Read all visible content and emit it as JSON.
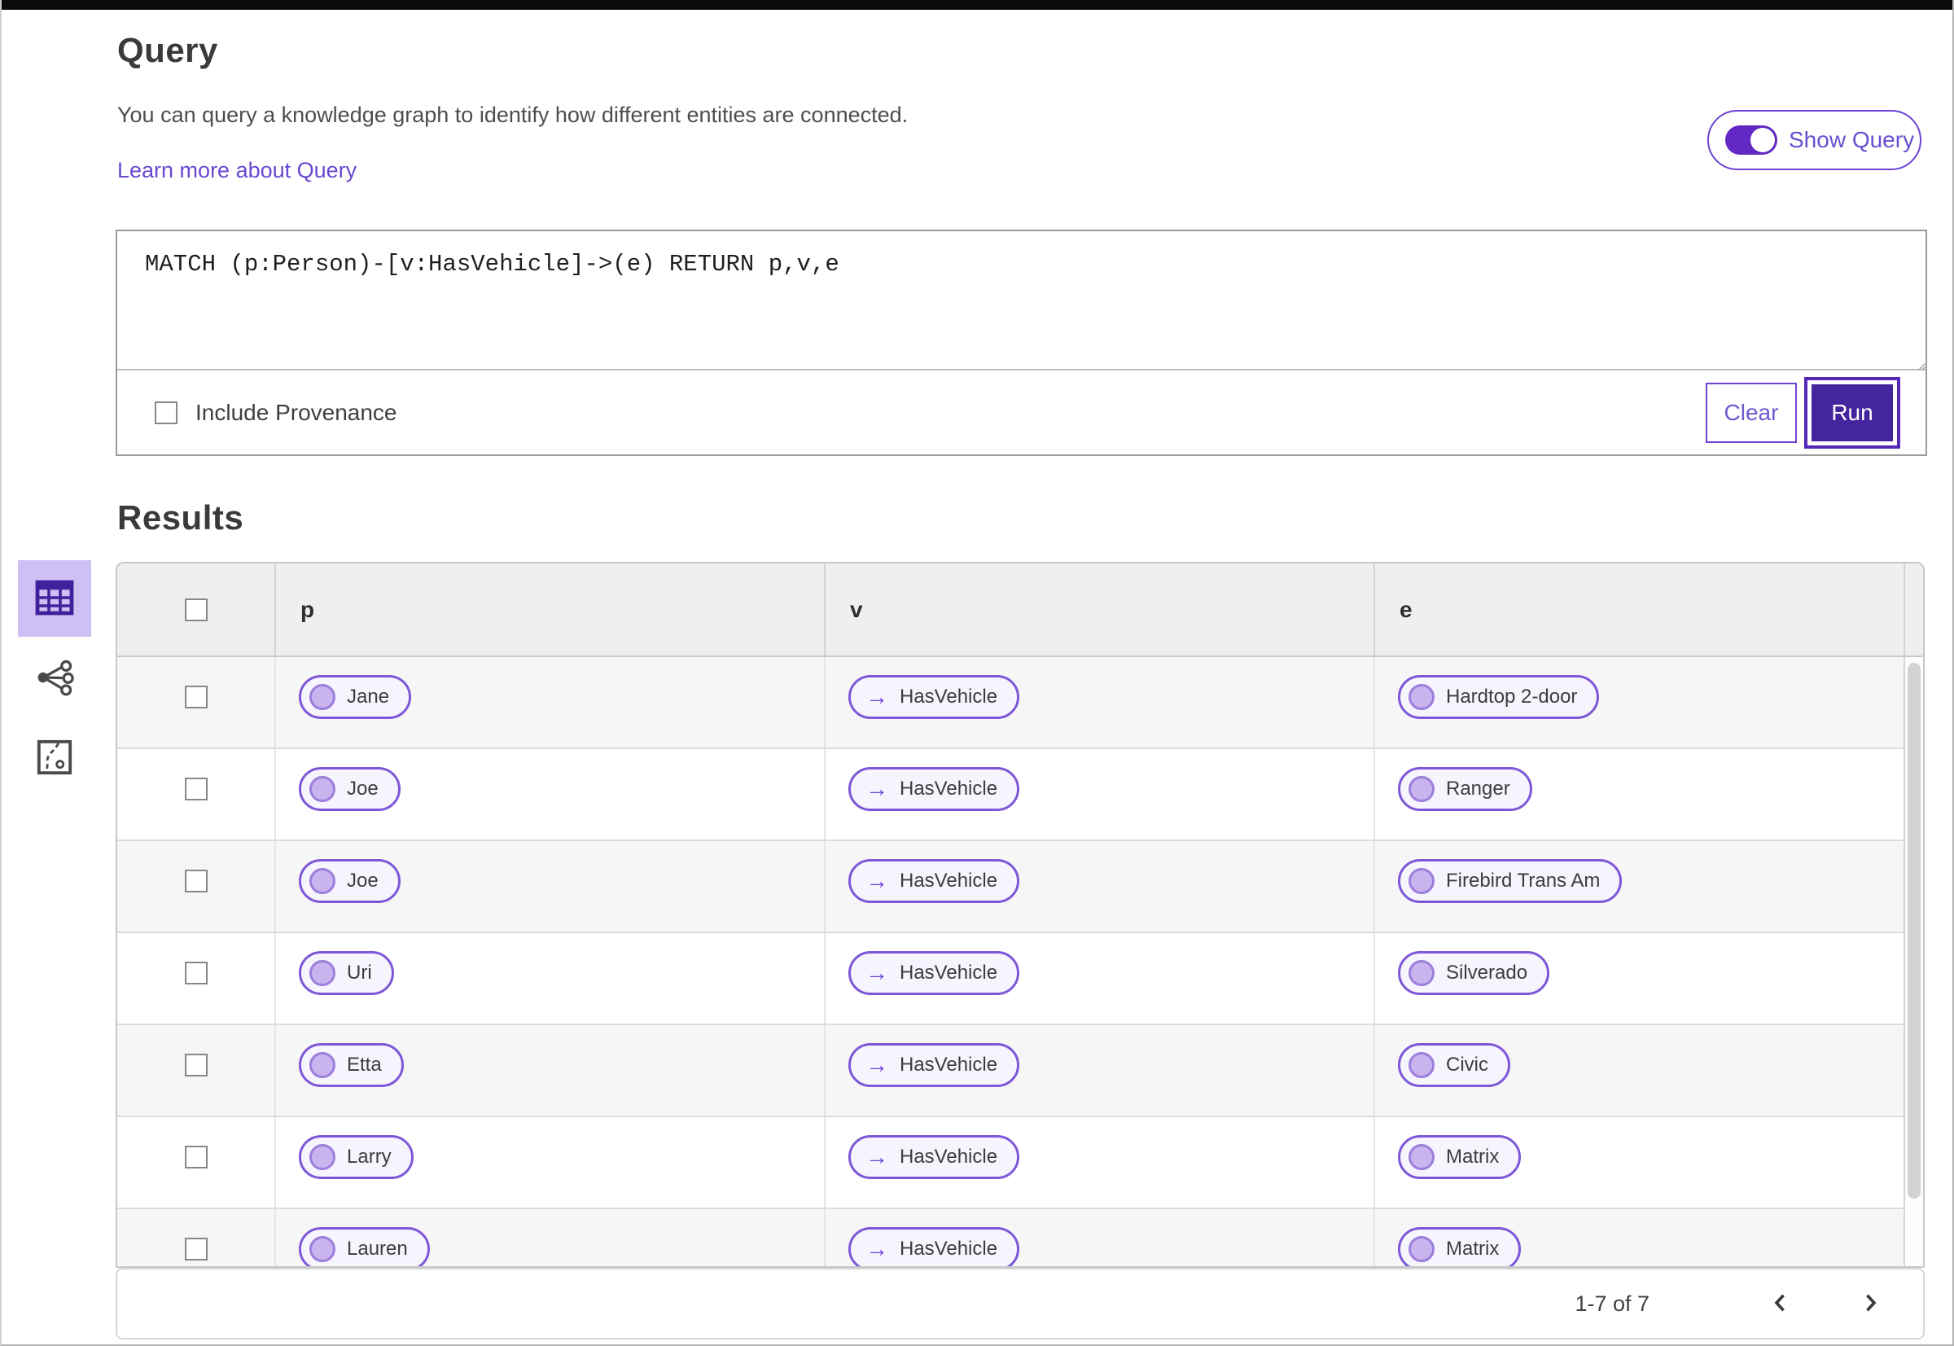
{
  "colors": {
    "accent_purple": "#6b40d6",
    "deep_purple_button": "#45259e",
    "pill_border": "#7e57d8",
    "selected_tile_bg": "#cec0f4",
    "link_purple": "#6a48d0",
    "table_header_bg": "#f0efef",
    "row_alt_bg": "#f6f6f6"
  },
  "query_panel": {
    "title": "Query",
    "description": "You can query a knowledge graph to identify how different entities are connected.",
    "learn_more_link": "Learn more about Query",
    "show_query_toggle": {
      "label": "Show Query",
      "state": "on"
    },
    "query_input": {
      "value": "MATCH (p:Person)-[v:HasVehicle]->(e) RETURN p,v,e"
    },
    "include_provenance": {
      "label": "Include Provenance",
      "checked": false
    },
    "buttons": {
      "clear": "Clear",
      "run": "Run"
    }
  },
  "results_panel": {
    "title": "Results",
    "view_switcher": [
      {
        "name": "table-view",
        "icon": "table-icon",
        "selected": true
      },
      {
        "name": "graph-view",
        "icon": "graph-icon",
        "selected": false
      },
      {
        "name": "map-view",
        "icon": "route-icon",
        "selected": false
      }
    ],
    "table": {
      "columns": [
        "p",
        "v",
        "e"
      ],
      "rows": [
        {
          "p": "Jane",
          "v": "HasVehicle",
          "e": "Hardtop 2-door"
        },
        {
          "p": "Joe",
          "v": "HasVehicle",
          "e": "Ranger"
        },
        {
          "p": "Joe",
          "v": "HasVehicle",
          "e": "Firebird Trans Am"
        },
        {
          "p": "Uri",
          "v": "HasVehicle",
          "e": "Silverado"
        },
        {
          "p": "Etta",
          "v": "HasVehicle",
          "e": "Civic"
        },
        {
          "p": "Larry",
          "v": "HasVehicle",
          "e": "Matrix"
        },
        {
          "p": "Lauren",
          "v": "HasVehicle",
          "e": "Matrix"
        }
      ]
    },
    "pagination": {
      "range_label": "1-7 of 7",
      "prev_icon": "chevron-left",
      "next_icon": "chevron-right"
    }
  }
}
